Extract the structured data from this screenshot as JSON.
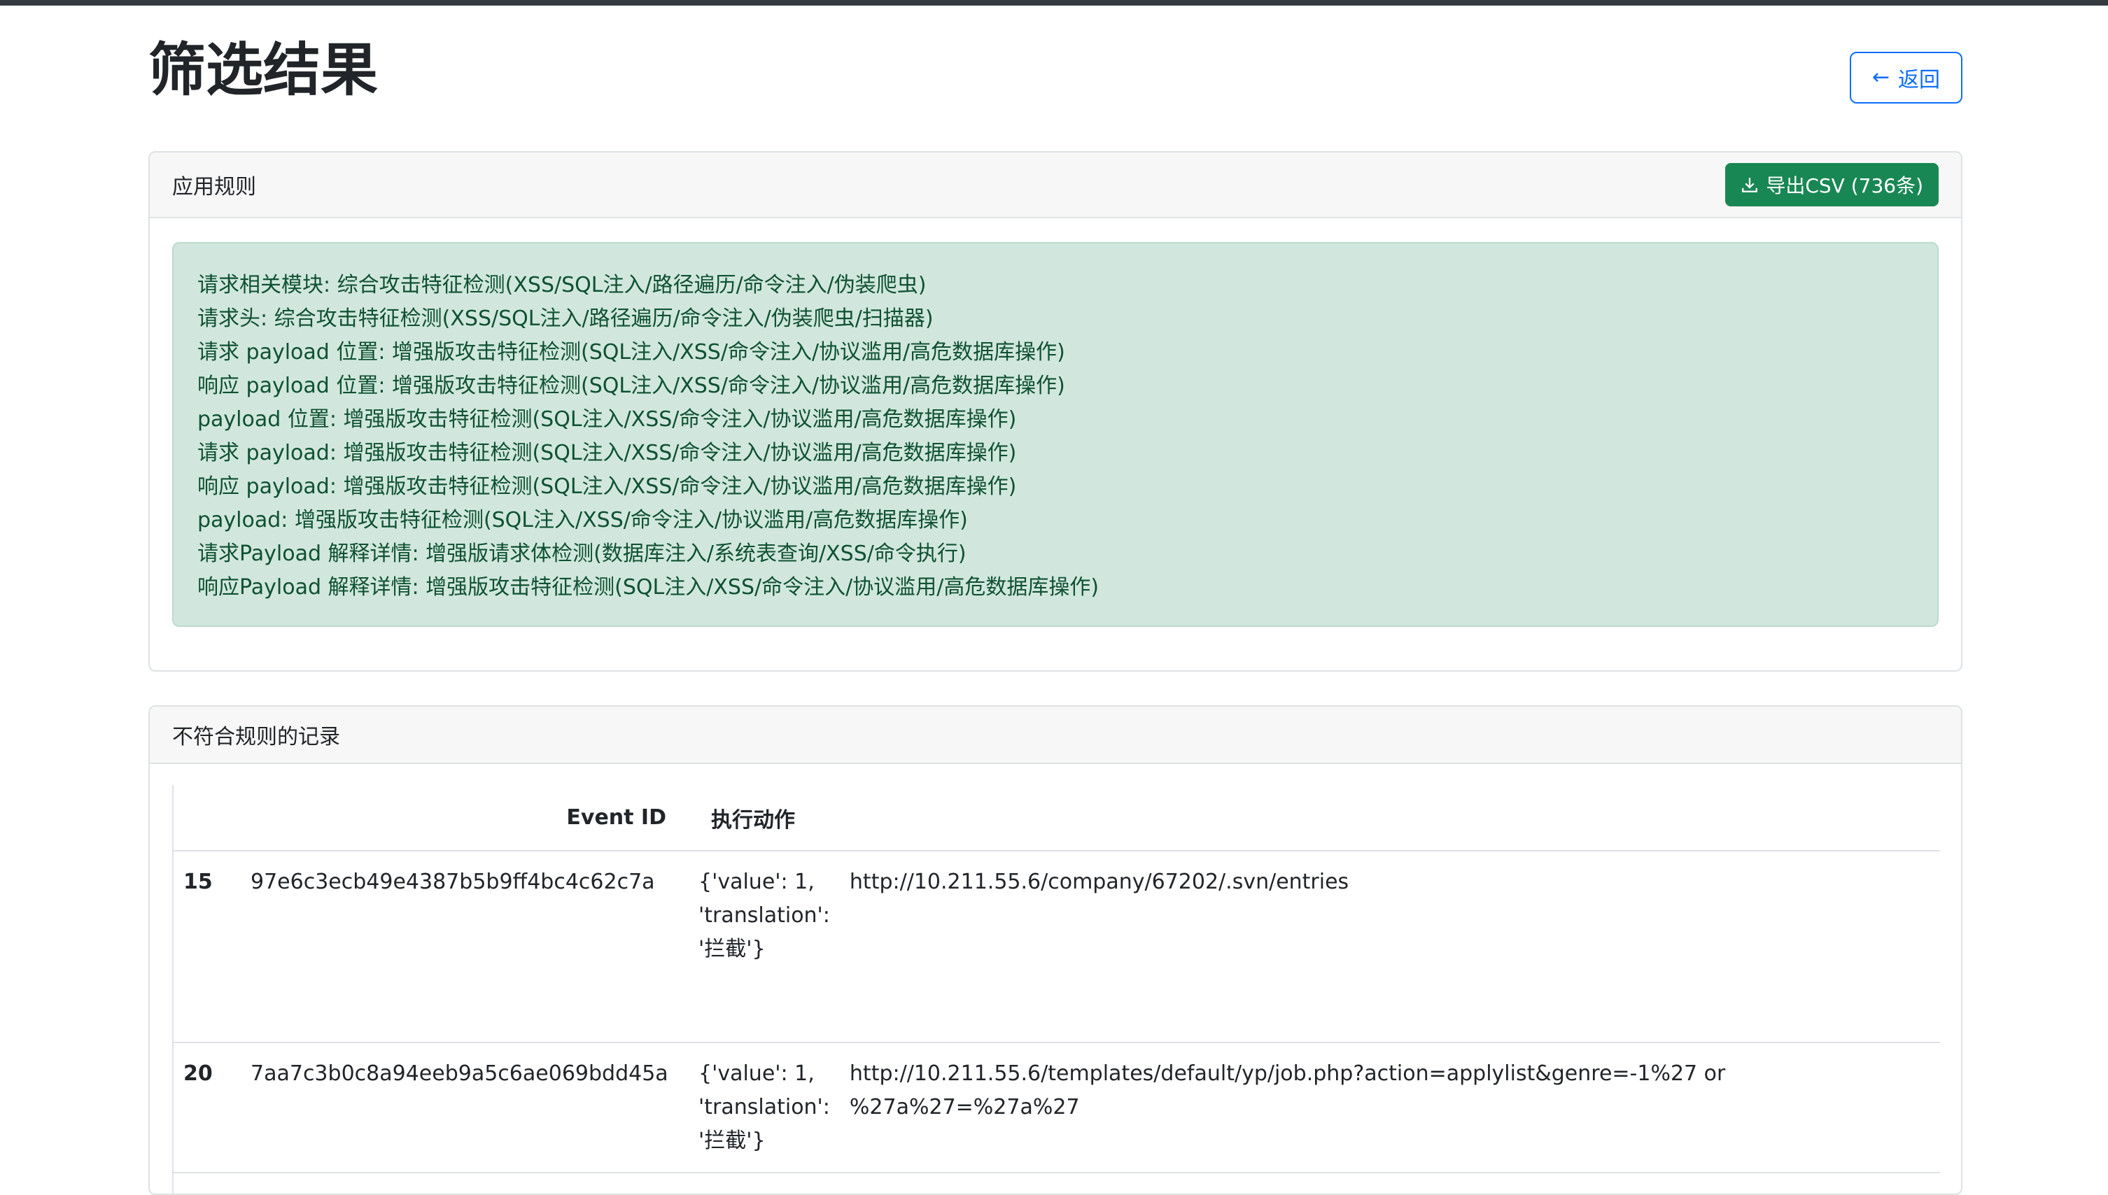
{
  "page": {
    "title": "筛选结果",
    "back_label": "返回"
  },
  "rules_card": {
    "header": "应用规则",
    "export_label": "导出CSV (736条)",
    "rules": [
      "请求相关模块: 综合攻击特征检测(XSS/SQL注入/路径遍历/命令注入/伪装爬虫)",
      "请求头: 综合攻击特征检测(XSS/SQL注入/路径遍历/命令注入/伪装爬虫/扫描器)",
      "请求 payload 位置: 增强版攻击特征检测(SQL注入/XSS/命令注入/协议滥用/高危数据库操作)",
      "响应 payload 位置: 增强版攻击特征检测(SQL注入/XSS/命令注入/协议滥用/高危数据库操作)",
      "payload 位置: 增强版攻击特征检测(SQL注入/XSS/命令注入/协议滥用/高危数据库操作)",
      "请求 payload: 增强版攻击特征检测(SQL注入/XSS/命令注入/协议滥用/高危数据库操作)",
      "响应 payload: 增强版攻击特征检测(SQL注入/XSS/命令注入/协议滥用/高危数据库操作)",
      "payload: 增强版攻击特征检测(SQL注入/XSS/命令注入/协议滥用/高危数据库操作)",
      "请求Payload 解释详情: 增强版请求体检测(数据库注入/系统表查询/XSS/命令执行)",
      "响应Payload 解释详情: 增强版攻击特征检测(SQL注入/XSS/命令注入/协议滥用/高危数据库操作)"
    ]
  },
  "records_card": {
    "header": "不符合规则的记录",
    "columns": [
      "Event ID",
      "执行动作"
    ],
    "rows": [
      {
        "num": "15",
        "event_id": "97e6c3ecb49e4387b5b9ff4bc4c62c7a",
        "action_lines": [
          "{'value': 1,",
          "'translation':",
          "'拦截'}"
        ],
        "url": "http://10.211.55.6/company/67202/.svn/entries"
      },
      {
        "num": "20",
        "event_id": "7aa7c3b0c8a94eeb9a5c6ae069bdd45a",
        "action_lines": [
          "{'value': 1,",
          "'translation':",
          "'拦截'}"
        ],
        "url": "http://10.211.55.6/templates/default/yp/job.php?action=applylist&genre=-1%27 or %27a%27=%27a%27"
      }
    ]
  },
  "colors": {
    "primary": "#0d6efd",
    "success": "#198754",
    "alert_bg": "#d1e7dd",
    "alert_text": "#0f5132",
    "top_bar": "#343a40"
  }
}
